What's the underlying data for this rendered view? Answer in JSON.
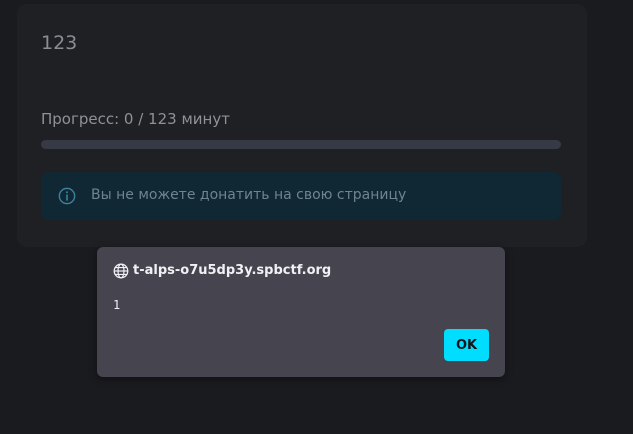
{
  "card": {
    "title": "123",
    "progress": {
      "label": "Прогресс: 0 / 123 минут",
      "current": 0,
      "total": 123,
      "fraction": 0
    },
    "alert": {
      "icon": "info-icon",
      "text": "Вы не можете донатить на свою страницу",
      "accent_color": "#3d7f9e"
    }
  },
  "alert_dialog": {
    "origin_icon": "globe-icon",
    "origin": "t-alps-o7u5dp3y.spbctf.org",
    "message": "1",
    "ok_label": "OK",
    "ok_color": "#00ddff"
  }
}
